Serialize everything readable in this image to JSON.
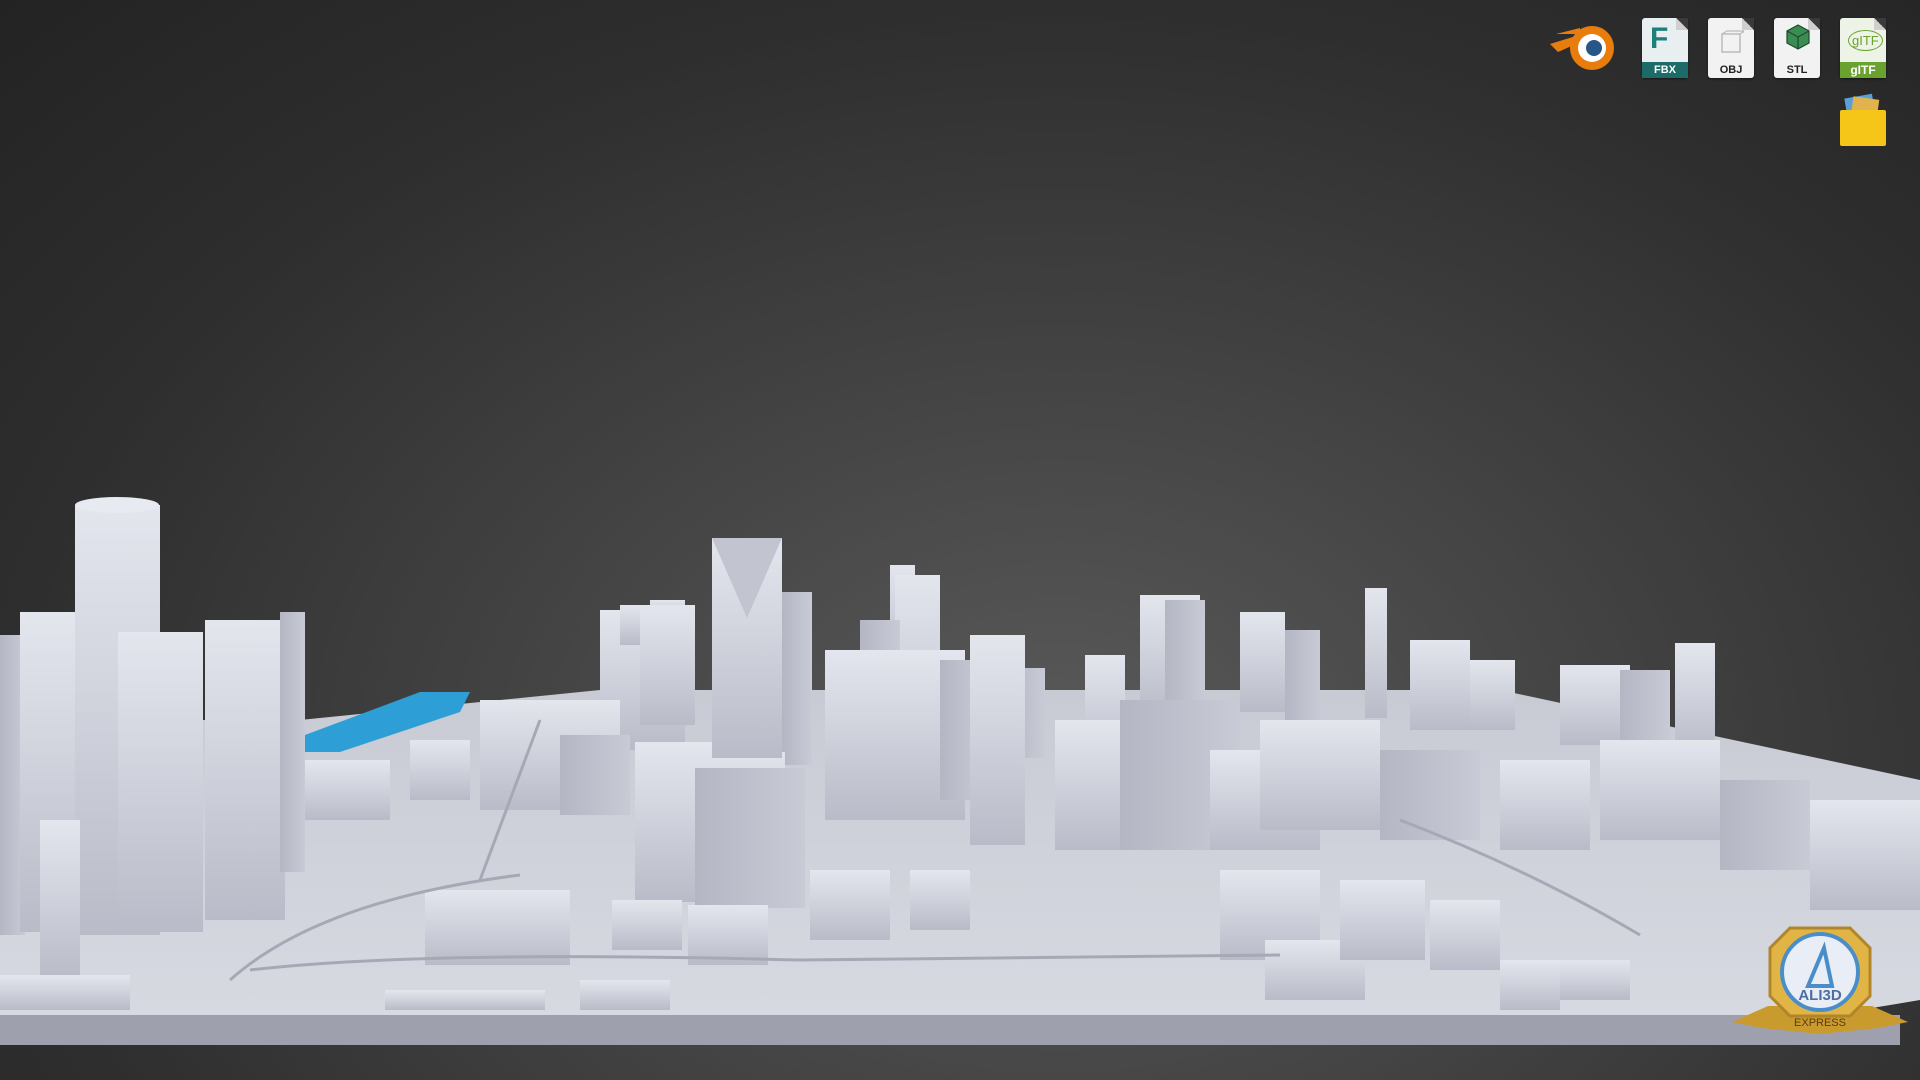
{
  "toolbar": {
    "formats": [
      {
        "name": "Blender",
        "label": ""
      },
      {
        "name": "FBX",
        "label": "FBX"
      },
      {
        "name": "OBJ",
        "label": "OBJ"
      },
      {
        "name": "STL",
        "label": "STL"
      },
      {
        "name": "glTF",
        "label": "gITF",
        "mark": "gITF"
      }
    ],
    "folder_icon": "folder-icon"
  },
  "badge": {
    "brand": "ALI3D",
    "tier": "EXPRESS"
  },
  "colors": {
    "background": "#2e2e2e",
    "buildings": "#c9ccd6",
    "highlight_parcel": "#2e9fd6",
    "badge_gold": "#d9a637",
    "badge_blue": "#4a8ec9"
  }
}
